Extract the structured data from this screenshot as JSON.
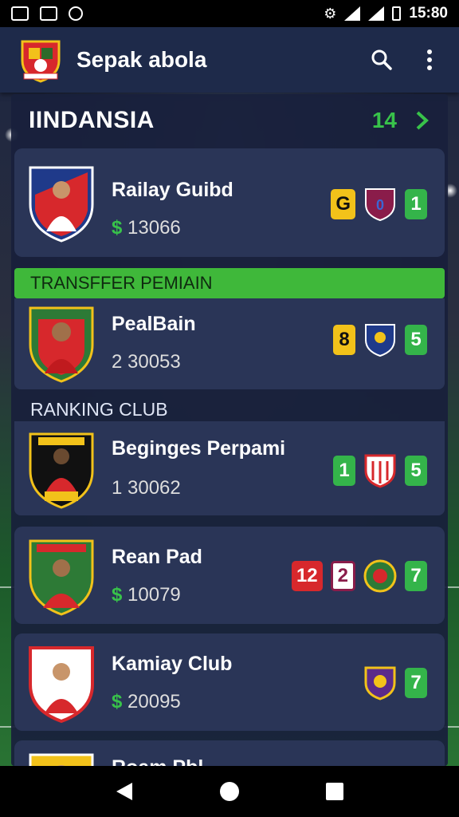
{
  "status": {
    "time": "15:80"
  },
  "app": {
    "title": "Sepak abola"
  },
  "section": {
    "title": "IINDANSIA",
    "count": "14"
  },
  "cards": [
    {
      "name": "Railay Guibd",
      "currency": "$",
      "value": "13066",
      "badges": [
        "G",
        "0",
        "1"
      ]
    },
    {
      "name": "PealBain",
      "currency": "",
      "value": "2 30053",
      "badges": [
        "8",
        "",
        "5"
      ]
    },
    {
      "name": "Beginges Perpami",
      "currency": "",
      "value": "1 30062",
      "badges": [
        "1",
        "",
        "5"
      ]
    },
    {
      "name": "Rean Pad",
      "currency": "$",
      "value": "10079",
      "badges": [
        "12",
        "2",
        "",
        "7"
      ]
    },
    {
      "name": "Kamiay Club",
      "currency": "$",
      "value": "20095",
      "badges": [
        "",
        "7"
      ]
    },
    {
      "name": "Roam Pbl"
    }
  ],
  "banners": {
    "transfer": "TRANSFFER PEMIAIN",
    "ranking": "RANKING CLUB"
  },
  "colors": {
    "accent_green": "#38c24a",
    "app_bar": "#1e2a4a",
    "card": "#2a3557",
    "badge_yellow": "#f2c21a",
    "badge_red": "#d7282c"
  },
  "icons": {
    "search": "search-icon",
    "more": "more-vert-icon",
    "chevron": "chevron-right-icon",
    "back": "back-icon",
    "home": "home-icon",
    "recents": "recents-icon"
  }
}
